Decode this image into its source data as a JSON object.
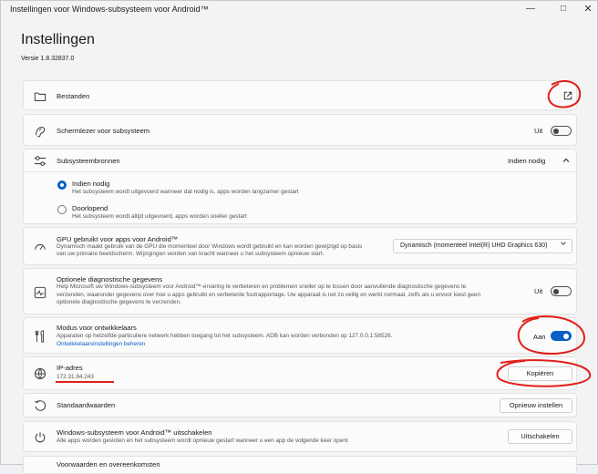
{
  "window": {
    "title": "Instellingen voor Windows-subsysteem voor Android™"
  },
  "header": {
    "title": "Instellingen",
    "version": "Versie 1.8.32837.0"
  },
  "files": {
    "label": "Bestanden"
  },
  "screenreader": {
    "label": "Schermlezer voor subsysteem",
    "state": "Uit",
    "on": false
  },
  "resources": {
    "label": "Subsysteembronnen",
    "value": "Indien nodig",
    "options": [
      {
        "label": "Indien nodig",
        "desc": "Het subsysteem wordt uitgevoerd wanneer dat nodig is, apps worden langzamer gestart",
        "selected": true
      },
      {
        "label": "Doorlopend",
        "desc": "Het subsysteem wordt altijd uitgevoerd, apps worden sneller gestart",
        "selected": false
      }
    ]
  },
  "gpu": {
    "label": "GPU gebruikt voor apps voor Android™",
    "desc1": "Dynamisch maakt gebruik van de GPU die momenteel door Windows wordt gebruikt en kan worden gewijzigd op basis",
    "desc2": "van uw primaire beeldscherm. Wijzigingen worden van kracht wanneer u het subsysteem opnieuw start.",
    "value": "Dynamisch (momenteel Intel(R) UHD Graphics 630)"
  },
  "diagnostics": {
    "label": "Optionele diagnostische gegevens",
    "desc1": "Help Microsoft uw Windows-subsysteem voor Android™-ervaring te verbeteren en problemen sneller op te lossen door aanvullende diagnostische gegevens te",
    "desc2": "verzenden, waaronder gegevens over hoe u apps gebruikt en verbeterde foutrapportage. Uw apparaat is net zo veilig en werkt normaal, zelfs als u ervoor kiest geen",
    "desc3": "optionele diagnostische gegevens te verzenden.",
    "state": "Uit",
    "on": false
  },
  "devmode": {
    "label": "Modus voor ontwikkelaars",
    "desc": "Apparaten op hetzelfde particuliere netwerk hebben toegang tot het subsysteem. ADB kan worden verbonden op 127.0.0.1:58526.",
    "link": "Ontwikkelaarsinstellingen beheren",
    "state": "Aan",
    "on": true
  },
  "ip": {
    "label": "IP-adres",
    "value": "172.31.84.243",
    "button": "Kopiëren"
  },
  "defaults": {
    "label": "Standaardwaarden",
    "button": "Opnieuw instellen"
  },
  "shutdown": {
    "label": "Windows-subsysteem voor Android™ uitschakelen",
    "desc": "Alle apps worden gesloten en het subsysteem wordt opnieuw gestart wanneer u een app de volgende keer opent",
    "button": "Uitschakelen"
  },
  "terms": {
    "label": "Voorwaarden en overeenkomsten"
  },
  "colors": {
    "accent": "#0a5fc5",
    "annotation": "#e0201b"
  }
}
